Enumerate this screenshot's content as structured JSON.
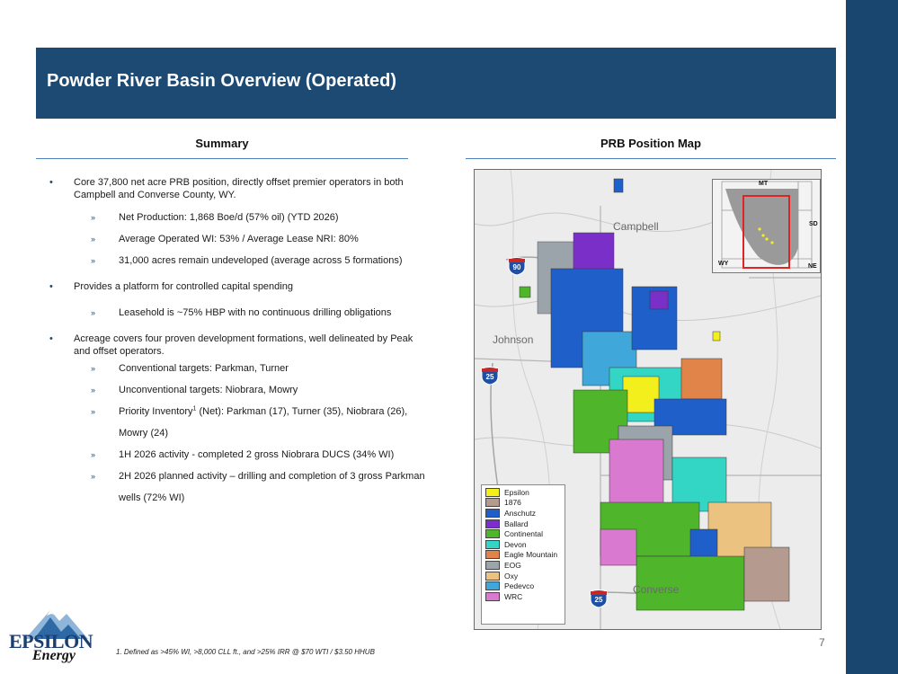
{
  "slide": {
    "title": "Powder River Basin Overview (Operated)",
    "page_number": "7",
    "footnote": "1.   Defined as >45% WI, >8,000 CLL ft., and >25% IRR @ $70 WTI / $3.50 HHUB"
  },
  "summary": {
    "heading": "Summary",
    "bullets": [
      {
        "text": "Core 37,800 net acre PRB position, directly offset premier operators in both Campbell and Converse County, WY.",
        "subs": [
          "Net Production: 1,868 Boe/d (57% oil) (YTD 2026)",
          "Average Operated WI: 53% / Average Lease NRI: 80%",
          "31,000 acres remain undeveloped (average across 5 formations)"
        ]
      },
      {
        "text": "Provides a platform for controlled capital spending",
        "subs": [
          "Leasehold is ~75% HBP with no continuous drilling obligations"
        ]
      },
      {
        "text": "Acreage covers four proven development formations, well delineated by Peak and offset operators.",
        "subs": [
          "Conventional targets: Parkman, Turner",
          "Unconventional targets: Niobrara, Mowry",
          "1H 2026 activity - completed 2 gross Niobrara DUCS (34% WI)",
          "2H 2026 planned activity – drilling and completion of 3 gross Parkman wells (72% WI)"
        ],
        "priority_sub": {
          "prefix": "Priority Inventory",
          "sup": "1",
          "suffix": " (Net): Parkman (17), Turner (35), Niobrara (26), Mowry (24)"
        }
      }
    ]
  },
  "map": {
    "heading": "PRB Position Map",
    "county_labels": [
      "Campbell",
      "Johnson",
      "Converse"
    ],
    "highways": [
      "90",
      "25",
      "25"
    ],
    "inset_labels": [
      "MT",
      "SD",
      "WY",
      "NE"
    ],
    "legend": [
      {
        "name": "Epsilon",
        "color": "#f2ef1c"
      },
      {
        "name": "1876",
        "color": "#b49a8f"
      },
      {
        "name": "Anschutz",
        "color": "#1f5fc9"
      },
      {
        "name": "Ballard",
        "color": "#7a2fc9"
      },
      {
        "name": "Continental",
        "color": "#4fb52a"
      },
      {
        "name": "Devon",
        "color": "#33d6c4"
      },
      {
        "name": "Eagle Mountain",
        "color": "#e0844a"
      },
      {
        "name": "EOG",
        "color": "#9ba3ab"
      },
      {
        "name": "Oxy",
        "color": "#ebc27f"
      },
      {
        "name": "Pedevco",
        "color": "#3fa7d9"
      },
      {
        "name": "WRC",
        "color": "#d97ad0"
      }
    ]
  },
  "logo": {
    "name": "EPSILON",
    "sub": "Energy"
  }
}
